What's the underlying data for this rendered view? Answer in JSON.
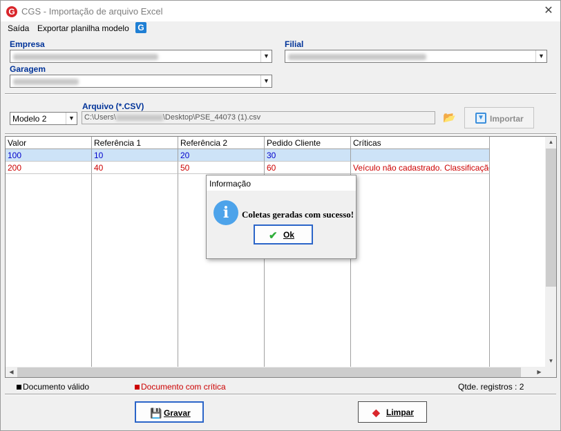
{
  "window": {
    "title": "CGS - Importação de arquivo Excel",
    "close_glyph": "✕",
    "logo_letter": "G"
  },
  "menu": {
    "items": [
      "Saída",
      "Exportar planilha modelo"
    ],
    "icon_letter": "G"
  },
  "filters": {
    "empresa_label": "Empresa",
    "filial_label": "Filial",
    "garagem_label": "Garagem"
  },
  "import": {
    "model_value": "Modelo 2",
    "file_label": "Arquivo (*.CSV)",
    "file_path_prefix": "C:\\Users\\",
    "file_path_suffix": "\\Desktop\\PSE_44073 (1).csv",
    "import_button": "Importar"
  },
  "grid": {
    "columns": [
      "Valor",
      "Referência 1",
      "Referência 2",
      "Pedido Cliente",
      "Críticas"
    ],
    "rows": [
      [
        "100",
        "10",
        "20",
        "30",
        ""
      ],
      [
        "200",
        "40",
        "50",
        "60",
        "Veículo não cadastrado. Classificação ..."
      ]
    ]
  },
  "legend": {
    "valid": "Documento válido",
    "critical": "Documento com crítica",
    "valid_color": "#000000",
    "critical_color": "#cc0000",
    "count": "Qtde. registros : 2"
  },
  "actions": {
    "save": "Gravar",
    "clear": "Limpar"
  },
  "dialog": {
    "title": "Informação",
    "message": "Coletas geradas com sucesso!",
    "ok": "Ok",
    "icon": "info-icon"
  },
  "colors": {
    "accent": "#2a64c8",
    "label_blue": "#003399",
    "row_selected_bg": "#cde3f7",
    "row_ok_text": "#0000cc",
    "row_error_text": "#cc0000"
  }
}
